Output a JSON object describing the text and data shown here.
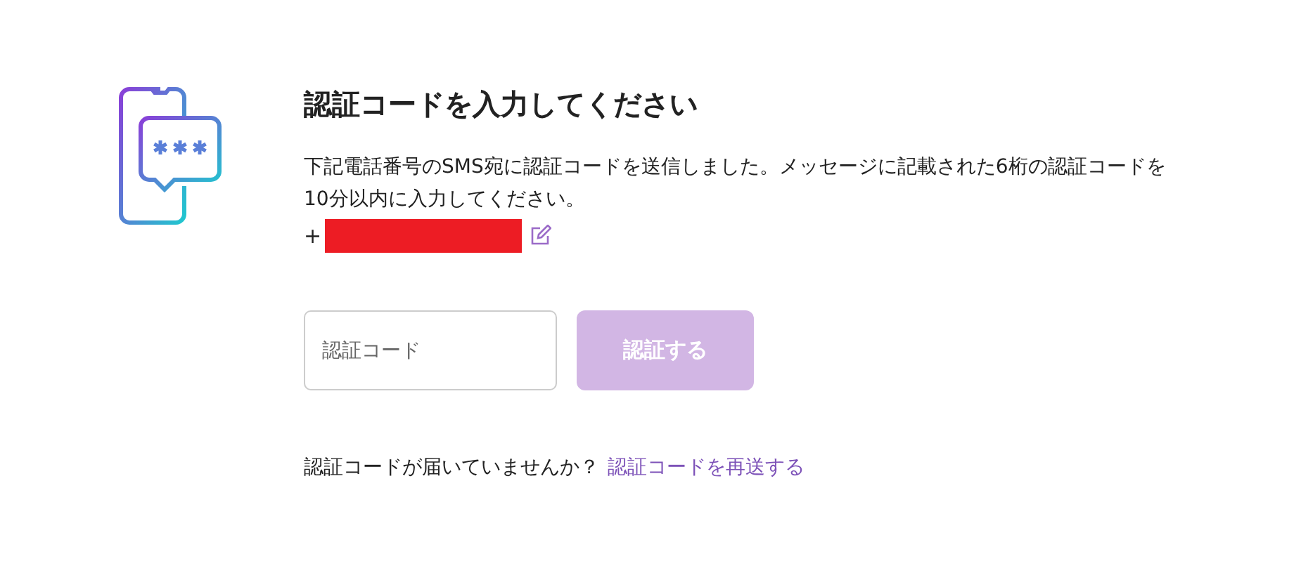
{
  "title": "認証コードを入力してください",
  "description": "下記電話番号のSMS宛に認証コードを送信しました。メッセージに記載された6桁の認証コードを10分以内に入力してください。",
  "phone": {
    "prefix": "+",
    "redacted": true
  },
  "code_field": {
    "placeholder": "認証コード"
  },
  "submit_button": {
    "label": "認証する",
    "disabled": true
  },
  "resend": {
    "prompt": "認証コードが届いていませんか？",
    "link": "認証コードを再送する"
  }
}
